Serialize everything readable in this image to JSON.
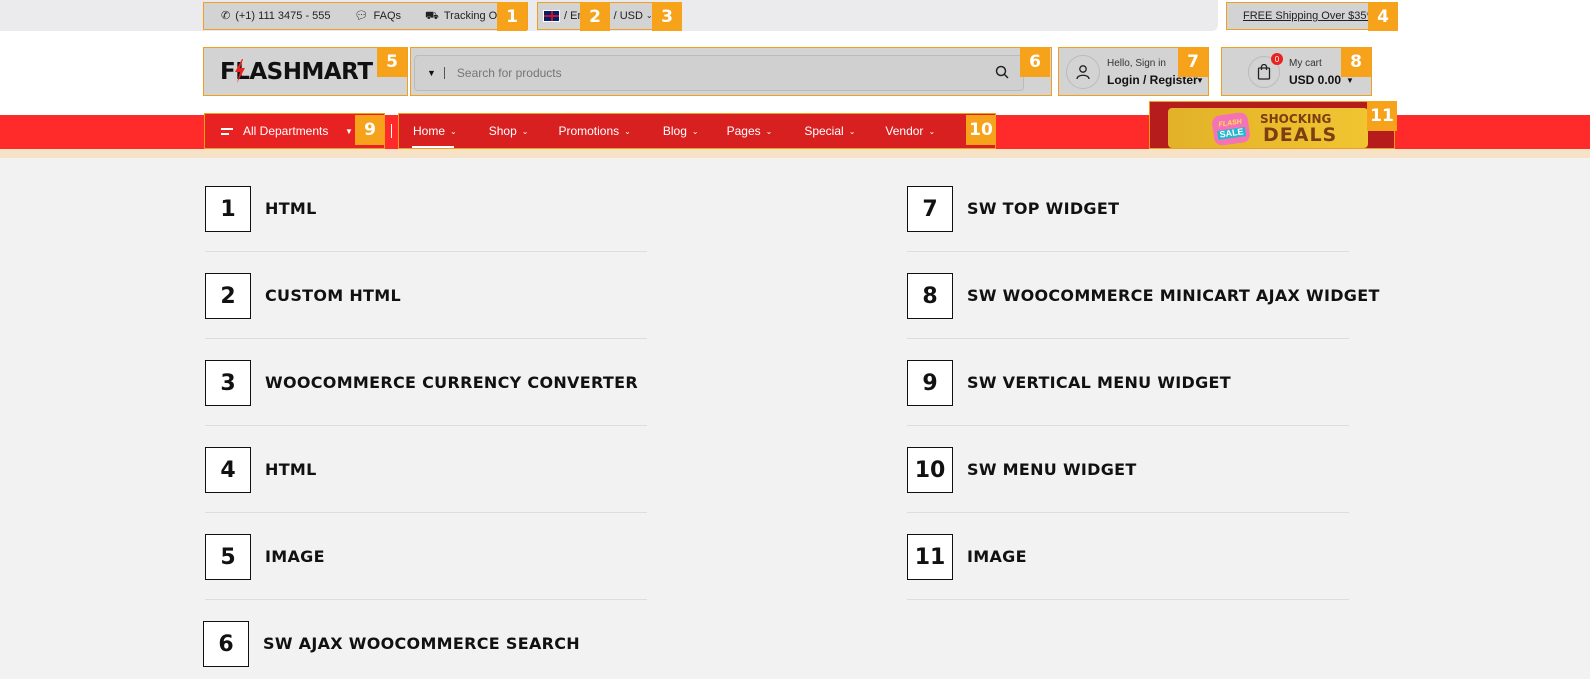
{
  "topbar": {
    "phone": "(+1) 111 3475 - 555",
    "faqs": "FAQs",
    "tracking": "Tracking Orde",
    "language": "/ En",
    "currency": "/ USD",
    "shipping": "FREE Shipping Over $35*"
  },
  "header": {
    "logo": "FLASHMART",
    "search_placeholder": "Search for products",
    "account_greeting": "Hello, Sign in",
    "account_action": "Login / Register",
    "cart_label": "My cart",
    "cart_total": "USD 0.00",
    "cart_count": "0"
  },
  "nav": {
    "departments": "All Departments",
    "items": [
      "Home",
      "Shop",
      "Promotions",
      "Blog",
      "Pages",
      "Special",
      "Vendor"
    ],
    "banner_top": "SHOCKING",
    "banner_bottom": "DEALS",
    "banner_flash": "FLASH",
    "banner_sale": "SALE"
  },
  "badges": [
    "1",
    "2",
    "3",
    "4",
    "5",
    "6",
    "7",
    "8",
    "9",
    "10",
    "11"
  ],
  "legend": [
    {
      "num": "1",
      "label": "HTML"
    },
    {
      "num": "2",
      "label": "CUSTOM HTML"
    },
    {
      "num": "3",
      "label": "WOOCOMMERCE CURRENCY CONVERTER"
    },
    {
      "num": "4",
      "label": "HTML"
    },
    {
      "num": "5",
      "label": "IMAGE"
    },
    {
      "num": "6",
      "label": "SW AJAX WOOCOMMERCE SEARCH"
    },
    {
      "num": "7",
      "label": "SW TOP WIDGET"
    },
    {
      "num": "8",
      "label": "SW WOOCOMMERCE MINICART AJAX WIDGET"
    },
    {
      "num": "9",
      "label": "SW VERTICAL MENU WIDGET"
    },
    {
      "num": "10",
      "label": "SW MENU WIDGET"
    },
    {
      "num": "11",
      "label": "IMAGE"
    }
  ],
  "colors": {
    "accent": "#f7a21b",
    "nav": "#ff2a2a",
    "brand_bolt": "#e8231f"
  }
}
